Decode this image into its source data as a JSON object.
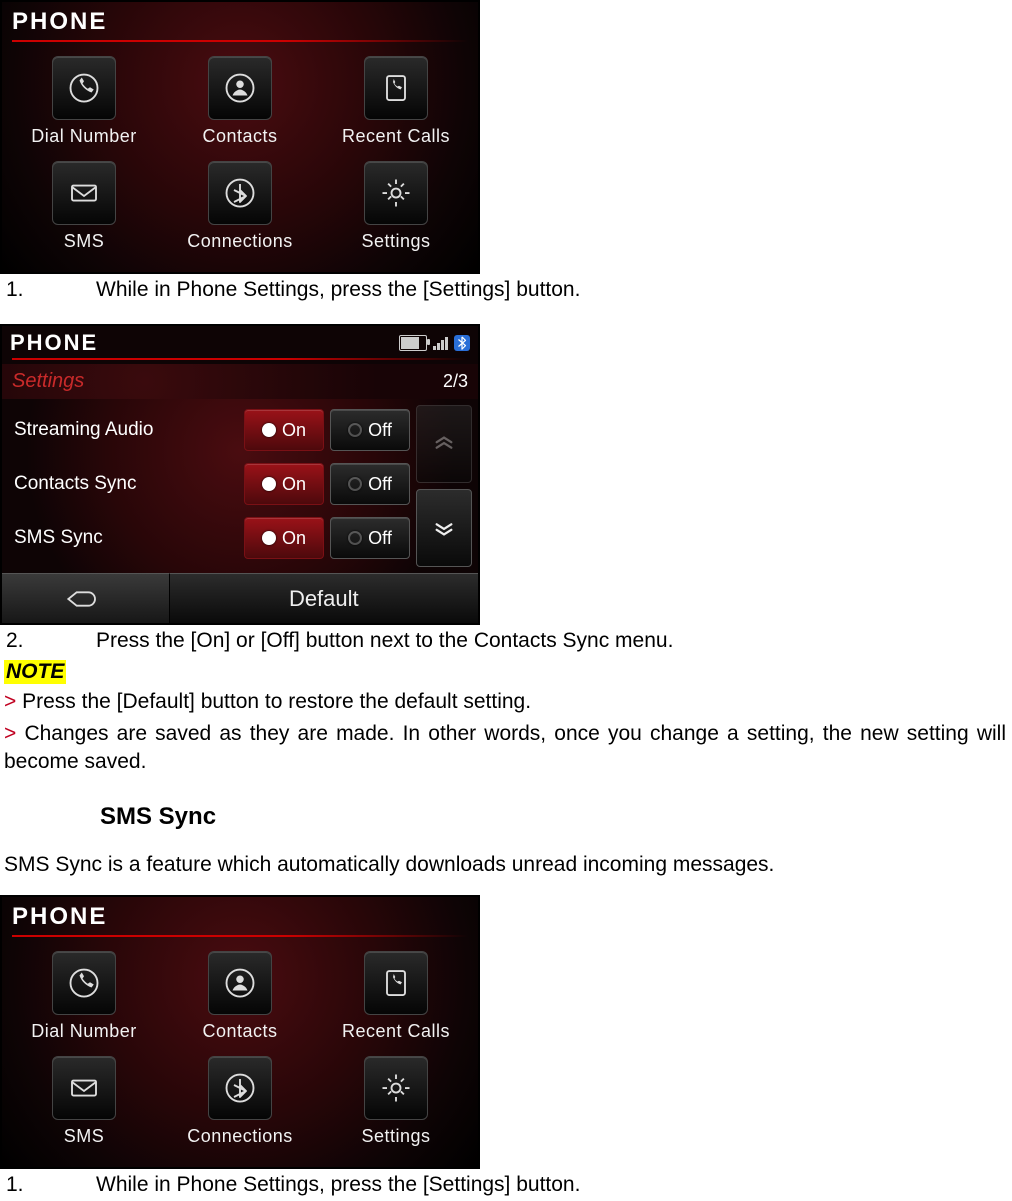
{
  "phone_menu": {
    "title": "PHONE",
    "items": [
      {
        "label": "Dial Number"
      },
      {
        "label": "Contacts"
      },
      {
        "label": "Recent Calls"
      },
      {
        "label": "SMS"
      },
      {
        "label": "Connections"
      },
      {
        "label": "Settings"
      }
    ]
  },
  "settings_screen": {
    "title": "PHONE",
    "subtitle": "Settings",
    "page": "2/3",
    "rows": [
      {
        "label": "Streaming Audio",
        "on": "On",
        "off": "Off"
      },
      {
        "label": "Contacts Sync",
        "on": "On",
        "off": "Off"
      },
      {
        "label": "SMS Sync",
        "on": "On",
        "off": "Off"
      }
    ],
    "default_label": "Default"
  },
  "doc": {
    "step1_num": "1.",
    "step1_text": "While in Phone Settings, press the [Settings] button.",
    "step2_num": "2.",
    "step2_text": "Press the [On] or [Off] button next to the Contacts Sync menu.",
    "note_label": "NOTE",
    "note1": "Press the [Default] button to restore the default setting.",
    "note2": "Changes are saved as they are made. In other words, once you change a setting, the new setting will become saved.",
    "section_heading": "SMS Sync",
    "section_desc": "SMS Sync is a feature which automatically downloads unread incoming messages.",
    "step3_num": "1.",
    "step3_text": "While in Phone Settings, press the [Settings] button."
  }
}
